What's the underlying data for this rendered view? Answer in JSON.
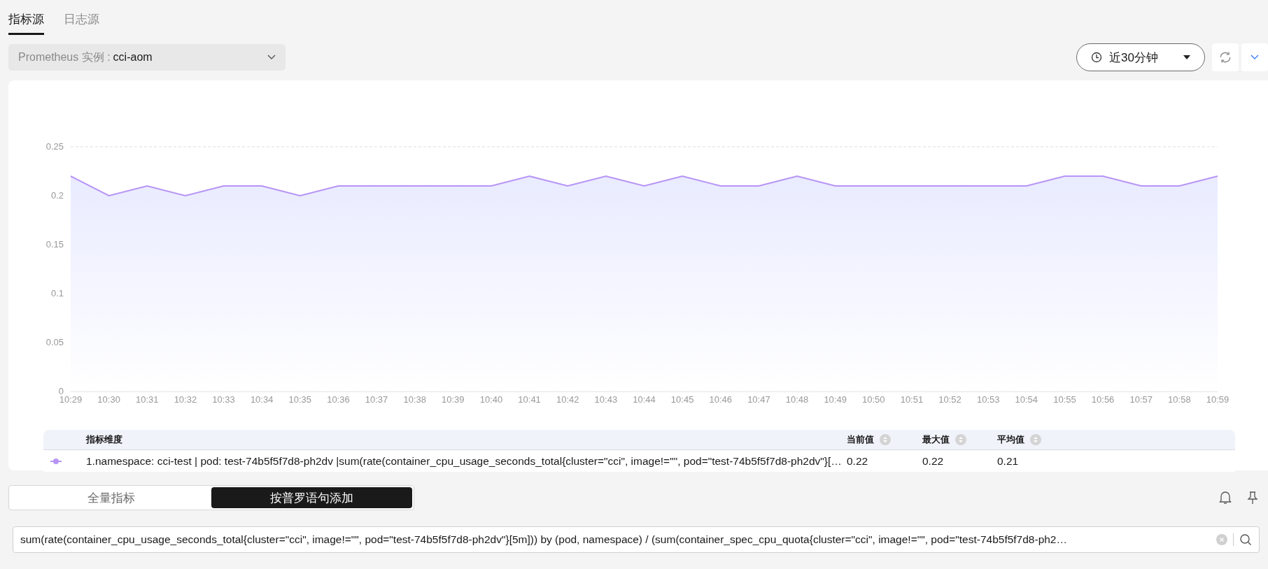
{
  "tabs": [
    {
      "label": "指标源",
      "selected": true
    },
    {
      "label": "日志源",
      "selected": false
    }
  ],
  "instance_select": {
    "label": "Prometheus 实例 :",
    "value": "cci-aom"
  },
  "time_range": {
    "value": "近30分钟"
  },
  "chart_data": {
    "type": "area",
    "categories": [
      "10:29",
      "10:30",
      "10:31",
      "10:32",
      "10:33",
      "10:34",
      "10:35",
      "10:36",
      "10:37",
      "10:38",
      "10:39",
      "10:40",
      "10:41",
      "10:42",
      "10:43",
      "10:44",
      "10:45",
      "10:46",
      "10:47",
      "10:48",
      "10:49",
      "10:50",
      "10:51",
      "10:52",
      "10:53",
      "10:54",
      "10:55",
      "10:56",
      "10:57",
      "10:58",
      "10:59"
    ],
    "series": [
      {
        "color": "#b794f6",
        "values": [
          0.22,
          0.2,
          0.21,
          0.2,
          0.21,
          0.21,
          0.2,
          0.21,
          0.21,
          0.21,
          0.21,
          0.21,
          0.22,
          0.21,
          0.22,
          0.21,
          0.22,
          0.21,
          0.21,
          0.22,
          0.21,
          0.21,
          0.21,
          0.21,
          0.21,
          0.21,
          0.22,
          0.22,
          0.21,
          0.21,
          0.22
        ]
      }
    ],
    "ylim": [
      0,
      0.25
    ],
    "yticks": [
      0,
      0.05,
      0.1,
      0.15,
      0.2,
      0.25
    ]
  },
  "legend": {
    "columns": [
      "指标维度",
      "当前值",
      "最大值",
      "平均值"
    ],
    "rows": [
      {
        "color": "#b794f6",
        "name": "1.namespace: cci-test | pod: test-74b5f5f7d8-ph2dv |sum(rate(container_cpu_usage_seconds_total{cluster=\"cci\", image!=\"\", pod=\"test-74b5f5f7d8-ph2dv\"}[…",
        "current": "0.22",
        "max": "0.22",
        "avg": "0.21"
      }
    ]
  },
  "mode_switch": [
    {
      "label": "全量指标",
      "selected": false
    },
    {
      "label": "按普罗语句添加",
      "selected": true
    }
  ],
  "query": {
    "value": "sum(rate(container_cpu_usage_seconds_total{cluster=\"cci\", image!=\"\", pod=\"test-74b5f5f7d8-ph2dv\"}[5m])) by (pod, namespace) / (sum(container_spec_cpu_quota{cluster=\"cci\", image!=\"\", pod=\"test-74b5f5f7d8-ph2…"
  }
}
